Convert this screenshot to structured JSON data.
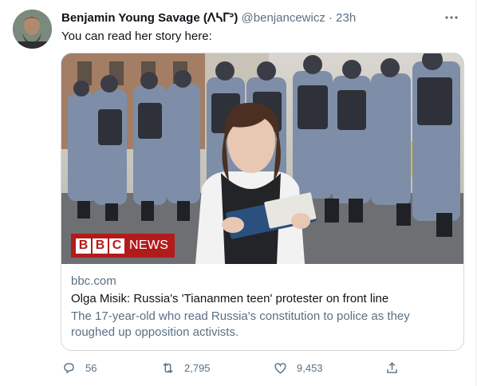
{
  "tweet": {
    "author_name": "Benjamin Young Savage (ᐱᓴᒥᐣ)",
    "author_handle": "@benjancewicz",
    "separator": "·",
    "time": "23h",
    "text": "You can read her story here:"
  },
  "card": {
    "image_logo_letters": [
      "B",
      "B",
      "C"
    ],
    "image_logo_word": "NEWS",
    "domain": "bbc.com",
    "title": "Olga Misik: Russia's 'Tiananmen teen' protester on front line",
    "description": "The 17-year-old who read Russia's constitution to police as they roughed up opposition activists."
  },
  "actions": {
    "reply_count": "56",
    "retweet_count": "2,795",
    "like_count": "9,453"
  },
  "icons": {
    "more": "more-horizontal-icon",
    "reply": "reply-icon",
    "retweet": "retweet-icon",
    "like": "heart-icon",
    "share": "share-icon"
  },
  "colors": {
    "secondary_text": "#5b7083",
    "border": "#cfd9de",
    "bbc_red": "#b31b1b"
  }
}
